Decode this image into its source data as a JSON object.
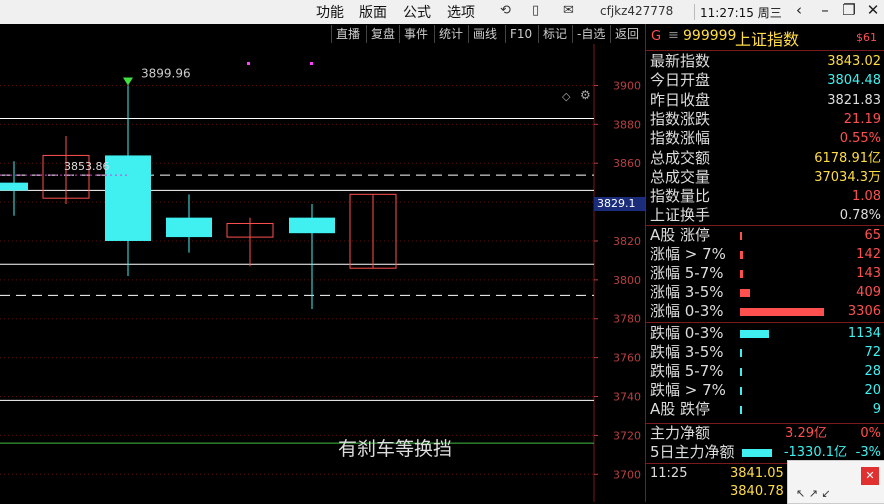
{
  "titlebar": {
    "menus": [
      "功能",
      "版面",
      "公式",
      "选项"
    ],
    "user": "cfjkz427778",
    "clock": "11:27:15 周三",
    "window_buttons": [
      "back-arrow",
      "minimize",
      "restore",
      "close"
    ]
  },
  "chart_toolbar": [
    "直播",
    "复盘",
    "事件",
    "统计",
    "画线",
    "F10",
    "标记",
    "-自选",
    "返回"
  ],
  "chart": {
    "y_ticks": [
      "3900",
      "3880",
      "3860",
      "3840",
      "3820",
      "3800",
      "3780",
      "3760",
      "3740",
      "3720",
      "3700"
    ],
    "high_label": "3899.96",
    "mid_label": "3853.86",
    "current_price": "3829.1",
    "overlay_text": "有刹车等换挡",
    "colors": {
      "up": "#ff5050",
      "down": "#40f0f0",
      "axis": "#b84040"
    }
  },
  "chart_data": {
    "type": "candlestick",
    "ylim": [
      3695,
      3910
    ],
    "candles": [
      {
        "open": 3850,
        "close": 3846,
        "high": 3861,
        "low": 3833
      },
      {
        "open": 3842,
        "close": 3864,
        "high": 3874,
        "low": 3839
      },
      {
        "open": 3864,
        "close": 3820,
        "high": 3899.96,
        "low": 3802
      },
      {
        "open": 3832,
        "close": 3822,
        "high": 3844,
        "low": 3814
      },
      {
        "open": 3822,
        "close": 3829,
        "high": 3832,
        "low": 3807
      },
      {
        "open": 3832,
        "close": 3824,
        "high": 3839,
        "low": 3785
      },
      {
        "open": 3806,
        "close": 3844,
        "high": 3844,
        "low": 3806
      }
    ],
    "h_lines": [
      {
        "y": 3883,
        "style": "solid",
        "color": "#ffffff"
      },
      {
        "y": 3853.86,
        "style": "dashed",
        "color": "#ffffff"
      },
      {
        "y": 3846,
        "style": "solid",
        "color": "#ffffff"
      },
      {
        "y": 3808,
        "style": "solid",
        "color": "#ffffff"
      },
      {
        "y": 3792,
        "style": "dashed",
        "color": "#ffffff"
      },
      {
        "y": 3738,
        "style": "solid",
        "color": "#ffffff"
      },
      {
        "y": 3716,
        "style": "solid",
        "color": "#40c040"
      }
    ]
  },
  "panel": {
    "code_prefix": "G",
    "code": "999999",
    "name": "上证指数",
    "tag": "$61",
    "stats": [
      {
        "label": "最新指数",
        "value": "3843.02",
        "color": "#ffdd44"
      },
      {
        "label": "今日开盘",
        "value": "3804.48",
        "color": "#40f0f0"
      },
      {
        "label": "昨日收盘",
        "value": "3821.83",
        "color": "#dddddd"
      },
      {
        "label": "指数涨跌",
        "value": "21.19",
        "color": "#ff5050"
      },
      {
        "label": "指数涨幅",
        "value": "0.55%",
        "color": "#ff5050"
      },
      {
        "label": "总成交额",
        "value": "6178.91亿",
        "color": "#ffdd44"
      },
      {
        "label": "总成交量",
        "value": "37034.3万",
        "color": "#ffdd44"
      },
      {
        "label": "指数量比",
        "value": "1.08",
        "color": "#ff5050"
      },
      {
        "label": "上证换手",
        "value": "0.78%",
        "color": "#dddddd"
      }
    ],
    "up_breadth": [
      {
        "label": "A股 涨停",
        "value": "65",
        "fill": 0.02
      },
      {
        "label": "涨幅 > 7%",
        "value": "142",
        "fill": 0.04
      },
      {
        "label": "涨幅 5-7%",
        "value": "143",
        "fill": 0.04
      },
      {
        "label": "涨幅 3-5%",
        "value": "409",
        "fill": 0.12
      },
      {
        "label": "涨幅 0-3%",
        "value": "3306",
        "fill": 1.0
      }
    ],
    "down_breadth": [
      {
        "label": "跌幅 0-3%",
        "value": "1134",
        "fill": 0.34
      },
      {
        "label": "跌幅 3-5%",
        "value": "72",
        "fill": 0.02
      },
      {
        "label": "跌幅 5-7%",
        "value": "28",
        "fill": 0.01
      },
      {
        "label": "跌幅 > 7%",
        "value": "20",
        "fill": 0.01
      },
      {
        "label": "A股 跌停",
        "value": "9",
        "fill": 0.005
      }
    ],
    "main_force": {
      "label": "主力净额",
      "value": "3.29亿",
      "pct": "0%"
    },
    "main_force5": {
      "label": "5日主力净额",
      "value": "-1330.1亿",
      "pct": "-3%"
    },
    "time": "11:25",
    "price1": "3841.05",
    "price2": "3840.78"
  }
}
